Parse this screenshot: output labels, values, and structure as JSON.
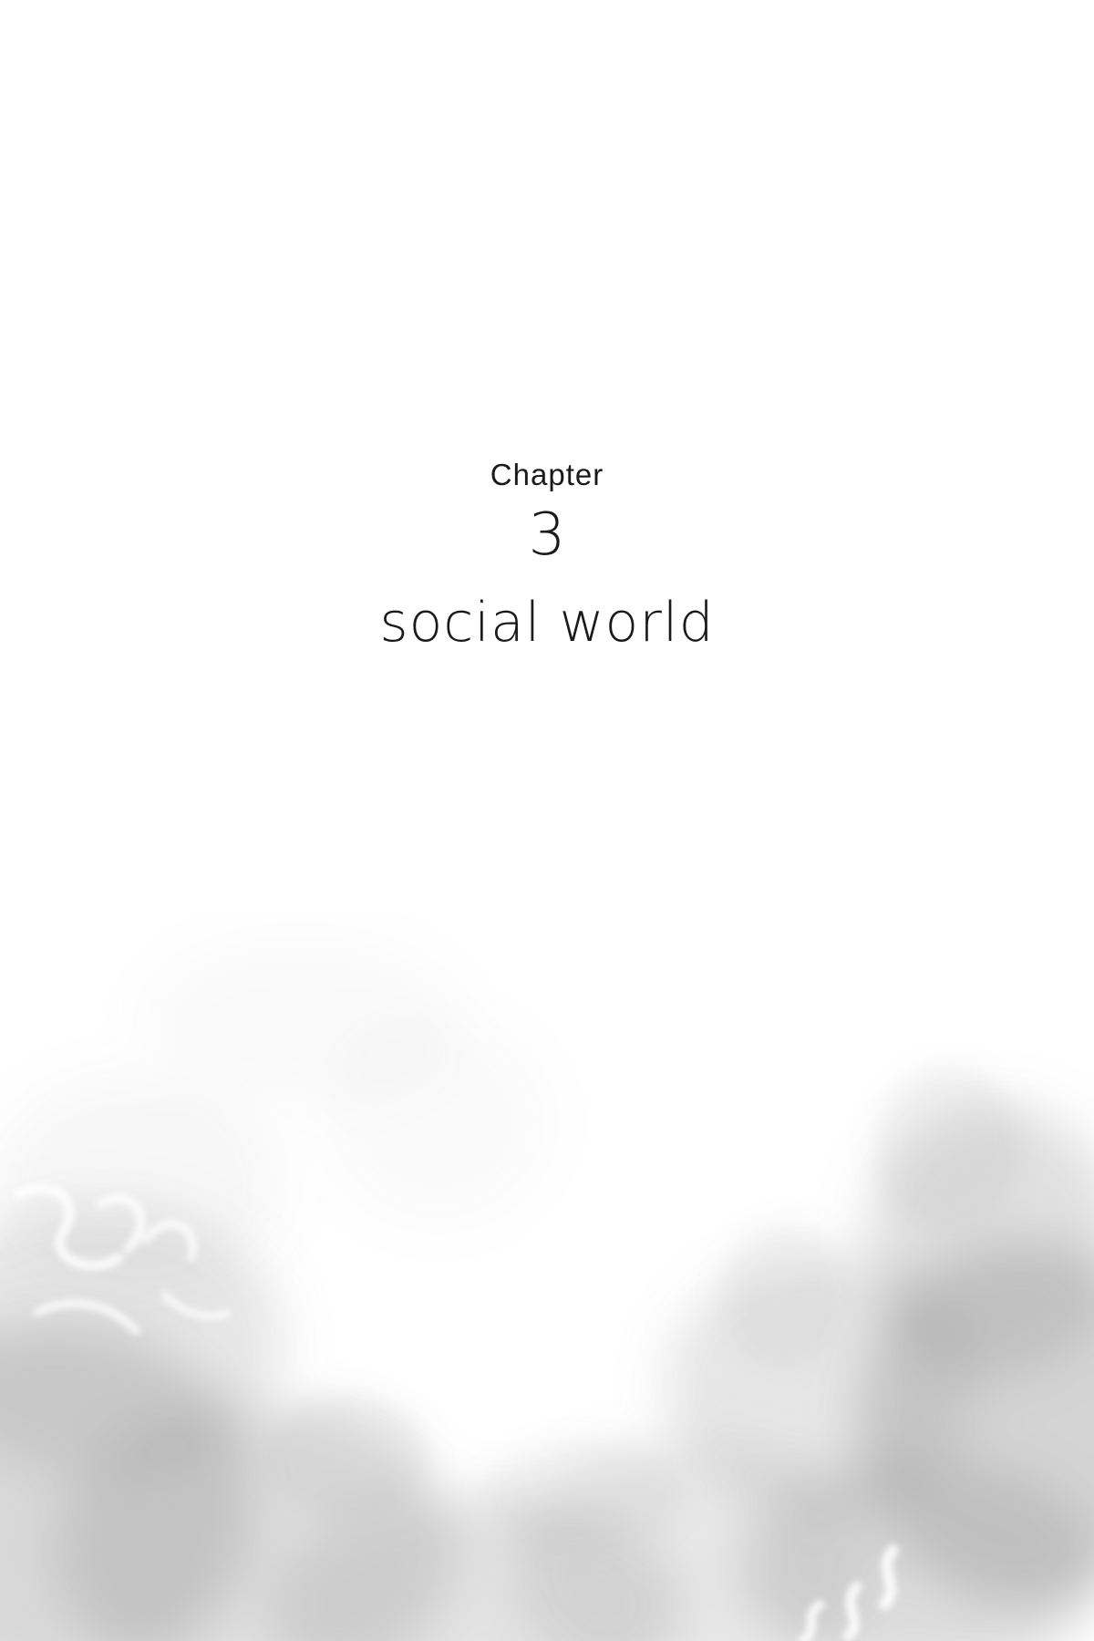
{
  "chapter": {
    "label": "Chapter",
    "number": "3",
    "title": "social world"
  },
  "colors": {
    "text": "#1a1a1a",
    "background": "#ffffff",
    "wash": "#9a9a9a"
  }
}
